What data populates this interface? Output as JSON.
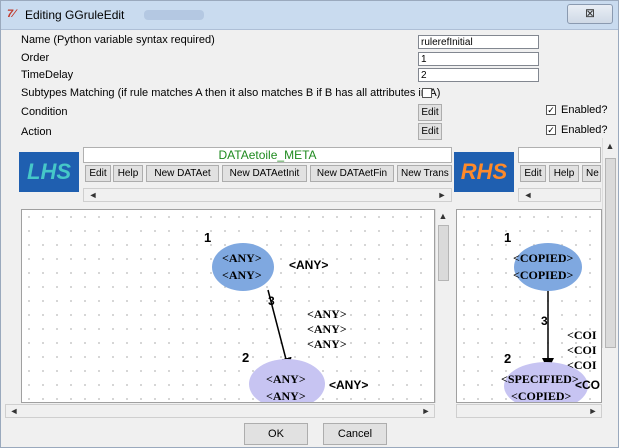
{
  "window": {
    "title_icon": "tk-feather-icon",
    "title": "Editing GGruleEdit",
    "close_symbol": "⊠"
  },
  "form": {
    "name_label": "Name (Python variable syntax required)",
    "name_value": "rulerefInitial",
    "order_label": "Order",
    "order_value": "1",
    "timedelay_label": "TimeDelay",
    "timedelay_value": "2",
    "subtypes_label": "Subtypes Matching (if rule matches A then it also matches B if B has all attributes in A)",
    "subtypes_checked": false,
    "condition_label": "Condition",
    "condition_edit": "Edit",
    "condition_enabled_label": "Enabled?",
    "condition_enabled_checked": true,
    "action_label": "Action",
    "action_edit": "Edit",
    "action_enabled_label": "Enabled?",
    "action_enabled_checked": true
  },
  "lhs": {
    "logo": "LHS",
    "meta_title": "DATAetoile_META",
    "buttons": [
      "Edit",
      "Help",
      "New DATAet",
      "New DATAetInit",
      "New DATAetFin",
      "New Trans"
    ],
    "nodes": [
      {
        "id": "1",
        "line1": "<ANY>",
        "line2": "<ANY>",
        "side_label": "<ANY>"
      },
      {
        "id": "2",
        "line1": "<ANY>",
        "line2": "<ANY>",
        "side_label": "<ANY>"
      }
    ],
    "edge_label": "3",
    "edge_attrs": [
      "<ANY>",
      "<ANY>",
      "<ANY>"
    ]
  },
  "rhs": {
    "logo": "RHS",
    "buttons": [
      "Edit",
      "Help",
      "Ne"
    ],
    "nodes": [
      {
        "id": "1",
        "line1": "<COPIED>",
        "line2": "<COPIED>"
      },
      {
        "id": "2",
        "line1": "<SPECIFIED>",
        "line2": "<COPIED>",
        "side_label": "<CO"
      }
    ],
    "edge_label": "3",
    "edge_attrs": [
      "<COI",
      "<COI",
      "<COI"
    ]
  },
  "footer": {
    "ok_label": "OK",
    "cancel_label": "Cancel"
  },
  "colors": {
    "lhs_node1": "#7fa8e0",
    "lhs_node2": "#c7c4f2",
    "rhs_node1": "#7fa8e0",
    "rhs_node2": "#c7c4f2",
    "meta_title": "#1f8a1f",
    "logo_bg": "#1f5fb0"
  }
}
